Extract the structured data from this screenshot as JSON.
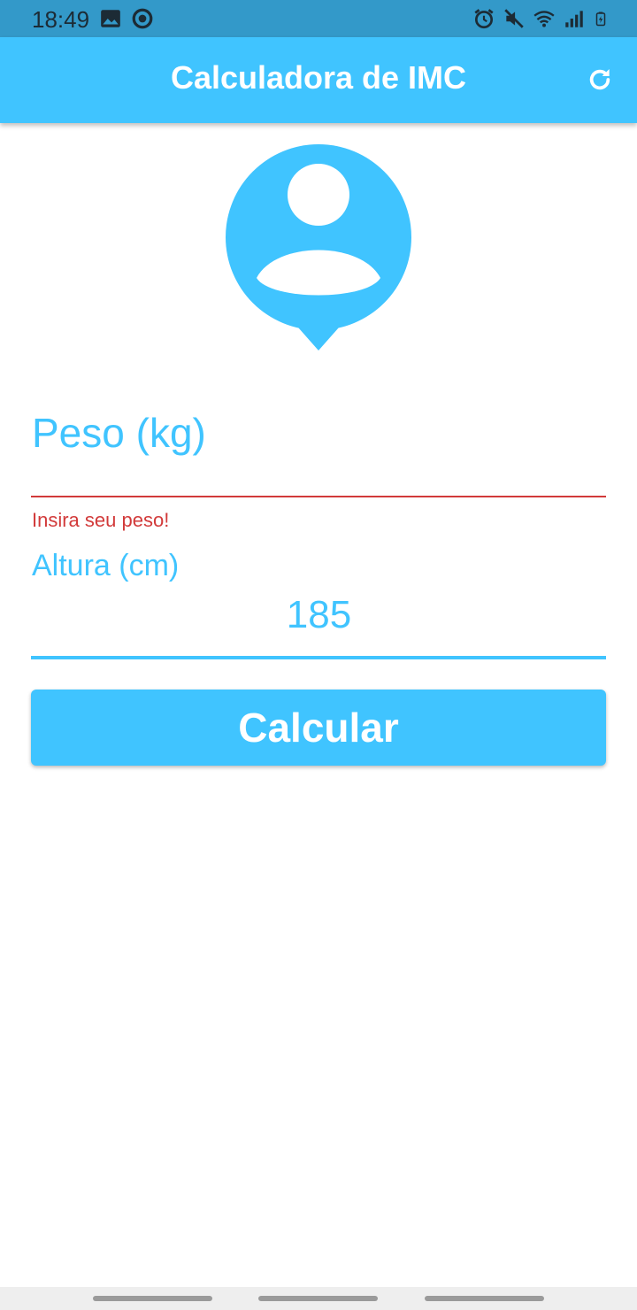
{
  "status_bar": {
    "time": "18:49",
    "left_icons": [
      "image-icon",
      "record-icon"
    ],
    "right_icons": [
      "alarm-icon",
      "mute-icon",
      "wifi-icon",
      "signal-icon",
      "battery-icon"
    ]
  },
  "app_bar": {
    "title": "Calculadora de IMC",
    "action_icon": "refresh-icon"
  },
  "avatar": {
    "icon": "person-pin-icon",
    "color": "#40c4ff"
  },
  "form": {
    "weight": {
      "label": "Peso (kg)",
      "value": "",
      "error": "Insira seu peso!"
    },
    "height": {
      "label": "Altura (cm)",
      "value": "185"
    },
    "submit_label": "Calcular"
  },
  "theme": {
    "accent": "#40c4ff",
    "status_bar": "#3399c9",
    "error": "#d23a3a"
  }
}
